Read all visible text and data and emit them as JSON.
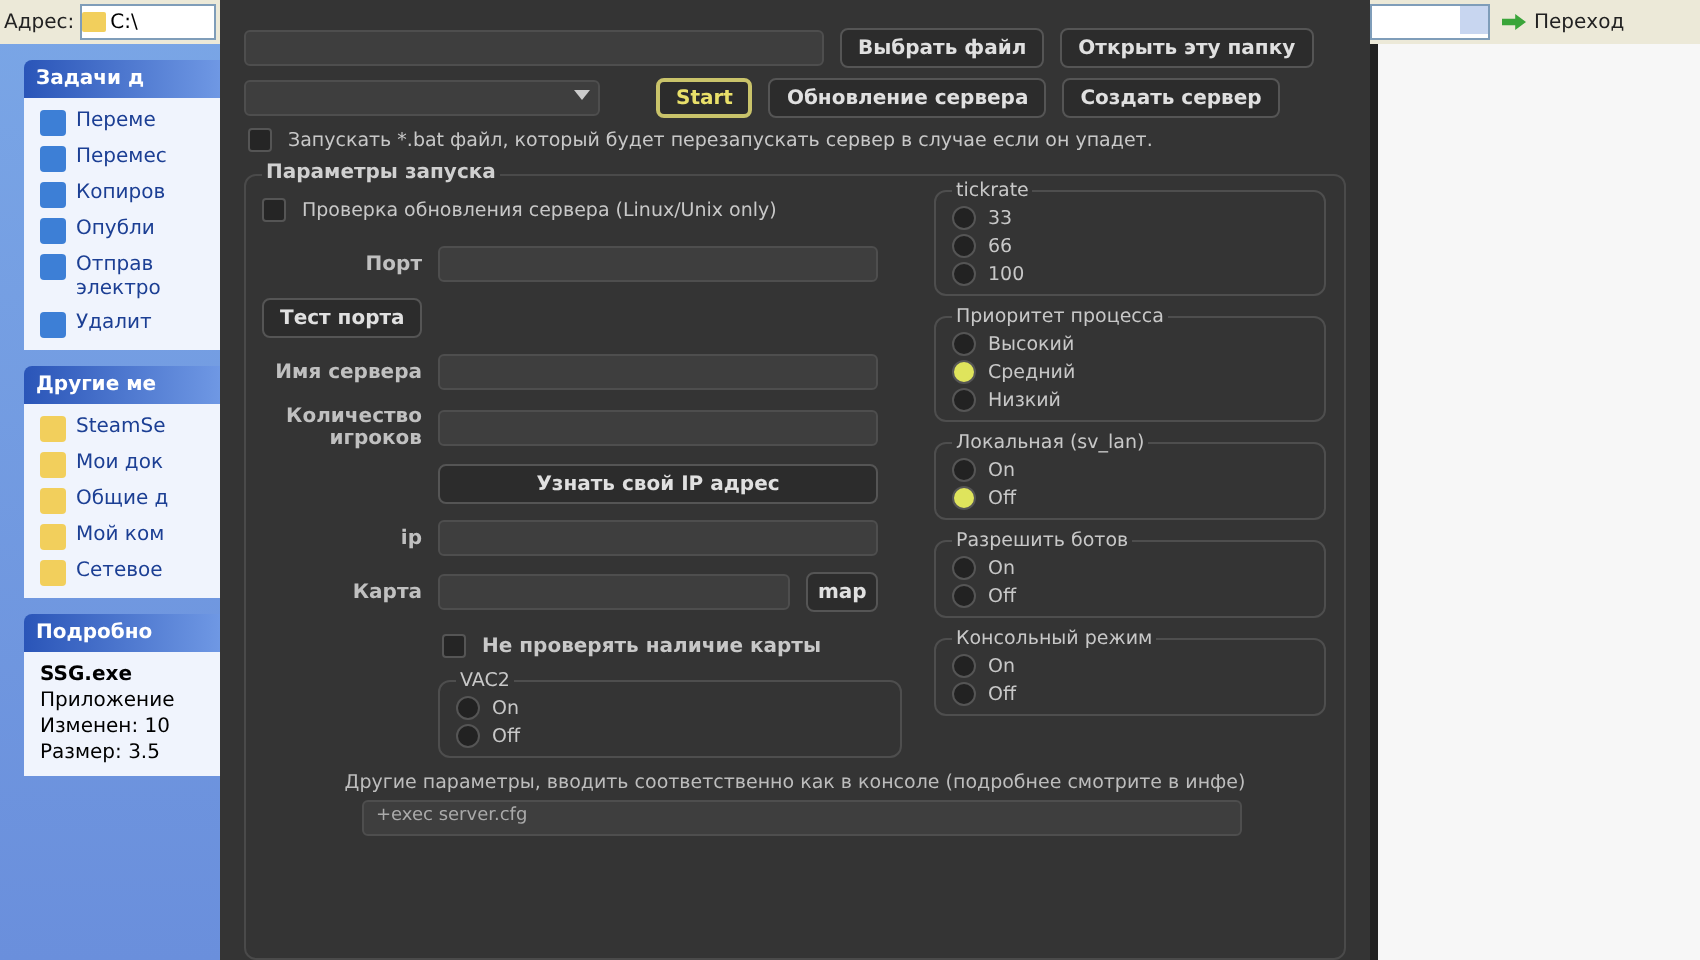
{
  "explorer": {
    "address_label": "Адрес:",
    "address_value": "C:\\",
    "go_button": "Переход",
    "panels": [
      {
        "title": "Задачи д",
        "items": [
          {
            "label": "Переме"
          },
          {
            "label": "Перемес"
          },
          {
            "label": "Копиров"
          },
          {
            "label": "Опубли"
          },
          {
            "label": "Отправ\nэлектро"
          },
          {
            "label": "Удалит"
          }
        ]
      },
      {
        "title": "Другие ме",
        "items": [
          {
            "label": "SteamSe"
          },
          {
            "label": "Мои док"
          },
          {
            "label": "Общие д"
          },
          {
            "label": "Мой ком"
          },
          {
            "label": "Сетевое"
          }
        ]
      }
    ],
    "details": {
      "title": "Подробно",
      "name": "SSG.exe",
      "lines": [
        "Приложение",
        "Изменен: 10",
        "Размер: 3.5"
      ]
    }
  },
  "app": {
    "top_buttons": [
      "Выбрать файл",
      "Открыть эту папку"
    ],
    "action_buttons": [
      {
        "label": "Start",
        "kind": "accent"
      },
      {
        "label": "Обновление сервера",
        "kind": "normal"
      },
      {
        "label": "Создать сервер",
        "kind": "normal"
      }
    ],
    "restart_checkbox": {
      "label": "Запускать *.bat файл, который будет перезапускать сервер в случае если он упадет.",
      "checked": false
    },
    "group_title": "Параметры запуска",
    "left_rows": [
      {
        "kind": "checkbox",
        "label": "Проверка обновления сервера (Linux/Unix only)",
        "checked": false
      },
      {
        "kind": "field",
        "label": "Порт"
      },
      {
        "kind": "button",
        "label": "Тест порта"
      },
      {
        "kind": "field",
        "label": "Имя сервера"
      },
      {
        "kind": "field",
        "label": "Количество игроков"
      },
      {
        "kind": "wide_button",
        "label": "Узнать свой IP адрес"
      },
      {
        "kind": "field",
        "label": "ip"
      },
      {
        "kind": "field_button",
        "label": "Карта",
        "button": "map"
      },
      {
        "kind": "checkbox_bold",
        "label": "Не проверять наличие карты",
        "checked": false
      },
      {
        "kind": "radio_group",
        "title": "VAC2",
        "options": [
          {
            "label": "On",
            "selected": false
          },
          {
            "label": "Off",
            "selected": false
          }
        ]
      }
    ],
    "radio_groups": [
      {
        "title": "tickrate",
        "options": [
          {
            "label": "33",
            "selected": false
          },
          {
            "label": "66",
            "selected": false
          },
          {
            "label": "100",
            "selected": false
          }
        ]
      },
      {
        "title": "Приоритет процесса",
        "options": [
          {
            "label": "Высокий",
            "selected": false
          },
          {
            "label": "Средний",
            "selected": true
          },
          {
            "label": "Низкий",
            "selected": false
          }
        ]
      },
      {
        "title": "Локальная (sv_lan)",
        "options": [
          {
            "label": "On",
            "selected": false
          },
          {
            "label": "Off",
            "selected": true
          }
        ]
      },
      {
        "title": "Разрешить ботов",
        "options": [
          {
            "label": "On",
            "selected": false
          },
          {
            "label": "Off",
            "selected": false
          }
        ]
      },
      {
        "title": "Консольный режим",
        "options": [
          {
            "label": "On",
            "selected": false
          },
          {
            "label": "Off",
            "selected": false
          }
        ]
      }
    ],
    "other_params_label": "Другие параметры, вводить соответственно как в консоле (подробнее смотрите в инфе)",
    "other_params_value": "+exec server.cfg"
  }
}
